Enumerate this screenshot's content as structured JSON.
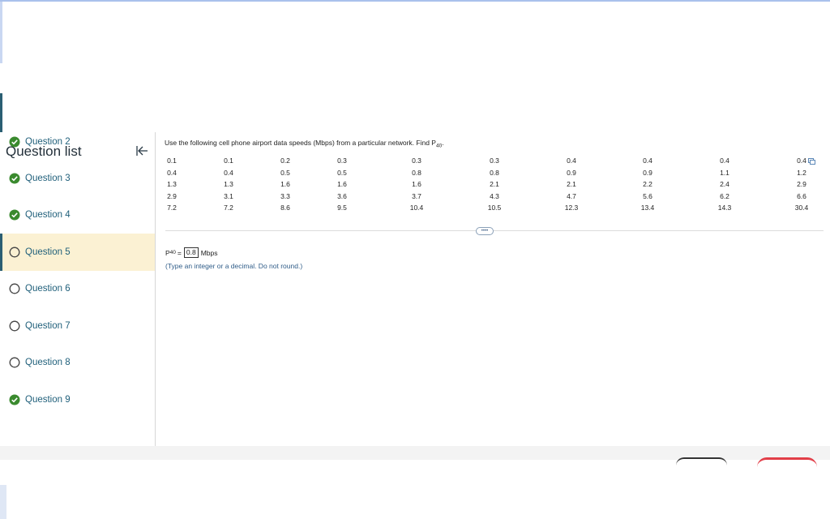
{
  "sidebar": {
    "title": "Question list",
    "items": [
      {
        "label": "Question 2",
        "status": "complete"
      },
      {
        "label": "Question 3",
        "status": "complete"
      },
      {
        "label": "Question 4",
        "status": "complete"
      },
      {
        "label": "Question 5",
        "status": "current"
      },
      {
        "label": "Question 6",
        "status": "incomplete"
      },
      {
        "label": "Question 7",
        "status": "incomplete"
      },
      {
        "label": "Question 8",
        "status": "incomplete"
      },
      {
        "label": "Question 9",
        "status": "complete"
      }
    ]
  },
  "question": {
    "prompt": "Use the following cell phone airport data speeds (Mbps) from a particular network. Find P",
    "prompt_sub": "40",
    "prompt_end": ".",
    "table": [
      [
        "0.1",
        "0.1",
        "0.2",
        "0.3",
        "0.3",
        "0.3",
        "0.4",
        "0.4",
        "0.4",
        "0.4"
      ],
      [
        "0.4",
        "0.4",
        "0.5",
        "0.5",
        "0.8",
        "0.8",
        "0.9",
        "0.9",
        "1.1",
        "1.2"
      ],
      [
        "1.3",
        "1.3",
        "1.6",
        "1.6",
        "1.6",
        "2.1",
        "2.1",
        "2.2",
        "2.4",
        "2.9"
      ],
      [
        "2.9",
        "3.1",
        "3.3",
        "3.6",
        "3.7",
        "4.3",
        "4.7",
        "5.6",
        "6.2",
        "6.6"
      ],
      [
        "7.2",
        "7.2",
        "8.6",
        "9.5",
        "10.4",
        "10.5",
        "12.3",
        "13.4",
        "14.3",
        "30.4"
      ]
    ],
    "more_label": "••••",
    "answer": {
      "prefix": "P",
      "sub": "40",
      "equals": "=",
      "value": "0.8",
      "unit": "Mbps"
    },
    "hint": "(Type an integer or a decimal. Do not round.)"
  },
  "colors": {
    "complete_green": "#3a8a2e",
    "link_blue": "#1f5f7a",
    "current_bg": "#fbf1d3",
    "accent_red": "#e23e48"
  },
  "icons": {
    "complete": "check-circle-icon",
    "incomplete": "empty-circle-icon",
    "collapse": "collapse-left-icon",
    "copy": "copy-icon"
  }
}
